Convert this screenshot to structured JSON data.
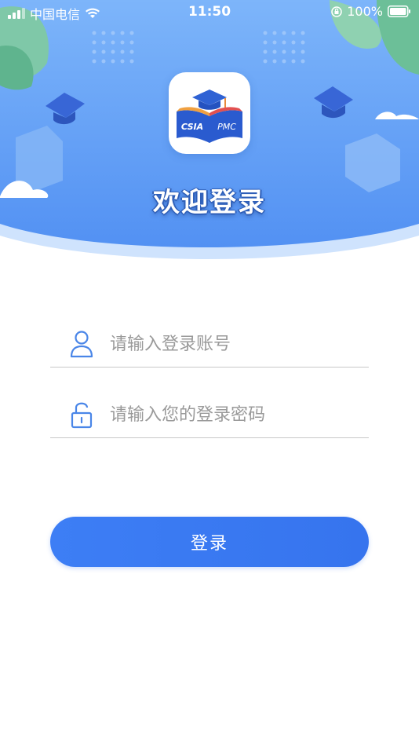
{
  "status_bar": {
    "carrier": "中国电信",
    "time": "11:50",
    "battery": "100%"
  },
  "header": {
    "logo_text_left": "CSIA",
    "logo_text_right": "PMC",
    "title": "欢迎登录"
  },
  "form": {
    "account_placeholder": "请输入登录账号",
    "password_placeholder": "请输入您的登录密码",
    "login_label": "登录"
  },
  "colors": {
    "primary": "#3a7af2",
    "header_sky": "#5a9af5",
    "icon_blue": "#4a86e8"
  }
}
